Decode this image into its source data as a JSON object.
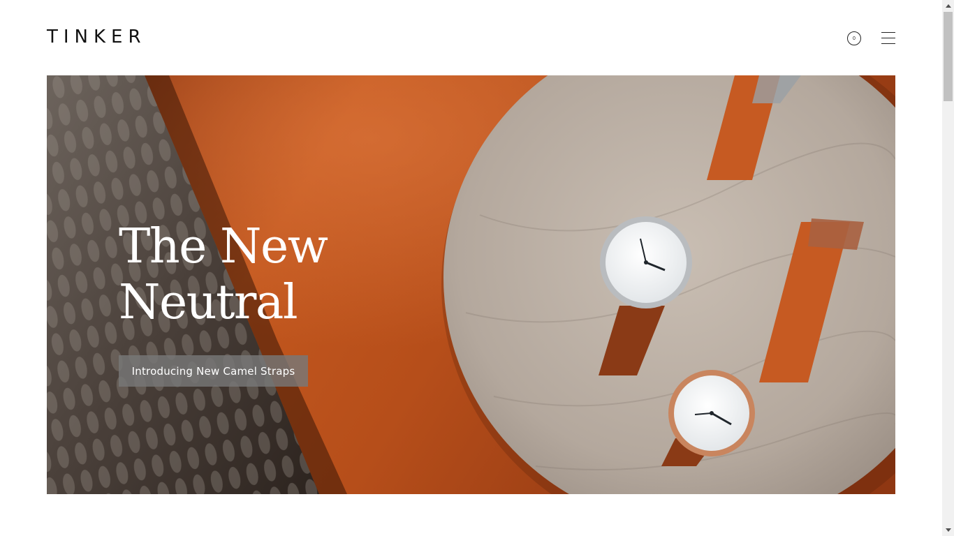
{
  "header": {
    "logo": "TINKER",
    "cart_count": "0"
  },
  "hero": {
    "title_line1": "The New",
    "title_line2": "Neutral",
    "cta_label": "Introducing New Camel Straps"
  },
  "icons": {
    "cart": "cart-icon",
    "menu": "hamburger-menu-icon"
  },
  "colors": {
    "leather": "#b4521d",
    "cta_bg": "#787878",
    "text_dark": "#111111"
  }
}
